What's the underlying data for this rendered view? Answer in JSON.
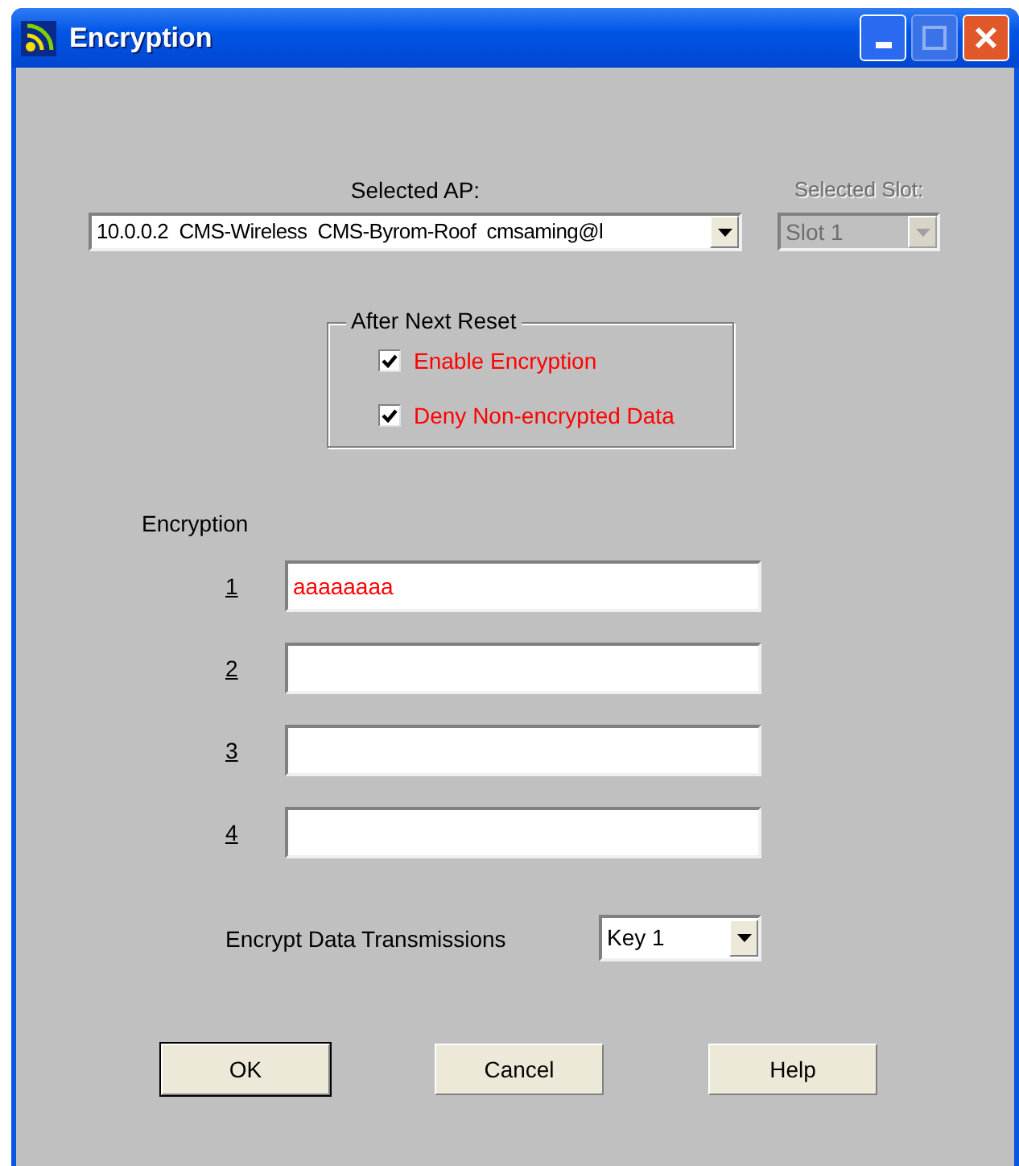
{
  "window": {
    "title": "Encryption"
  },
  "selected_ap": {
    "label": "Selected AP:",
    "value": "10.0.0.2  CMS-Wireless  CMS-Byrom-Roof  cmsaming@l"
  },
  "selected_slot": {
    "label": "Selected Slot:",
    "value": "Slot 1",
    "disabled": true
  },
  "after_next_reset": {
    "title": "After Next Reset",
    "options": [
      {
        "label": "Enable Encryption",
        "checked": true
      },
      {
        "label": "Deny Non-encrypted Data",
        "checked": true
      }
    ]
  },
  "encryption": {
    "label": "Encryption",
    "keys": [
      {
        "label": "1",
        "value": "aaaaaaaa"
      },
      {
        "label": "2"
      },
      {
        "label": "3"
      },
      {
        "label": "4"
      }
    ]
  },
  "encrypt_data_transmissions": {
    "label": "Encrypt Data Transmissions",
    "value": "Key 1"
  },
  "buttons": [
    {
      "label": "OK",
      "default": true
    },
    {
      "label": "Cancel",
      "default": false
    },
    {
      "label": "Help",
      "default": false
    }
  ]
}
